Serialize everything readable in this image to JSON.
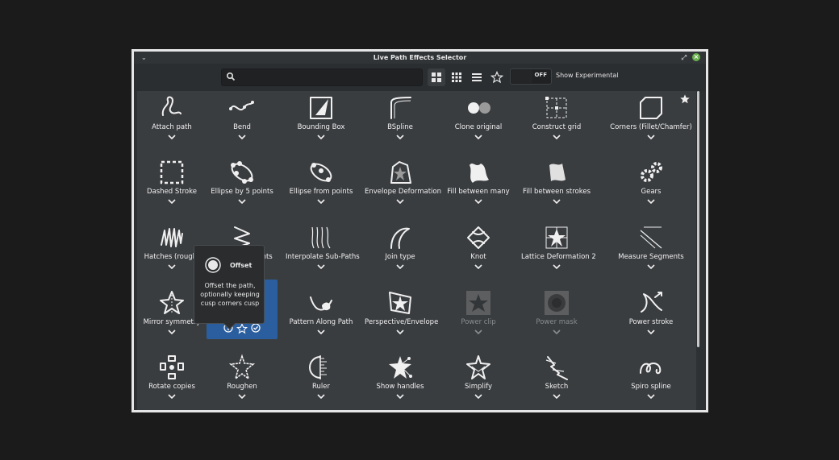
{
  "window": {
    "title": "Live Path Effects Selector"
  },
  "search": {
    "placeholder": ""
  },
  "toolbar": {
    "experimental_state": "OFF",
    "experimental_label": "Show Experimental"
  },
  "effects": [
    "Attach path",
    "Bend",
    "Bounding Box",
    "BSpline",
    "Clone original",
    "Construct grid",
    "Corners (Fillet/Chamfer)",
    "Dashed Stroke",
    "Ellipse by 5 points",
    "Ellipse from points",
    "Envelope Deformation",
    "Fill between many",
    "Fill between strokes",
    "Gears",
    "Hatches (rough)",
    "Interpolate points",
    "Interpolate Sub-Paths",
    "Join type",
    "Knot",
    "Lattice Deformation 2",
    "Measure Segments",
    "Mirror symmetry",
    "Offset",
    "Pattern Along Path",
    "Perspective/Envelope",
    "Power clip",
    "Power mask",
    "Power stroke",
    "Rotate copies",
    "Roughen",
    "Ruler",
    "Show handles",
    "Simplify",
    "Sketch",
    "Spiro spline"
  ],
  "tooltip": {
    "title": "Offset",
    "description": "Offset the path, optionally keeping cusp corners cusp"
  },
  "colors": {
    "accent": "#2b5e9e",
    "background": "#3a3d40",
    "text": "#f0f0f0"
  }
}
